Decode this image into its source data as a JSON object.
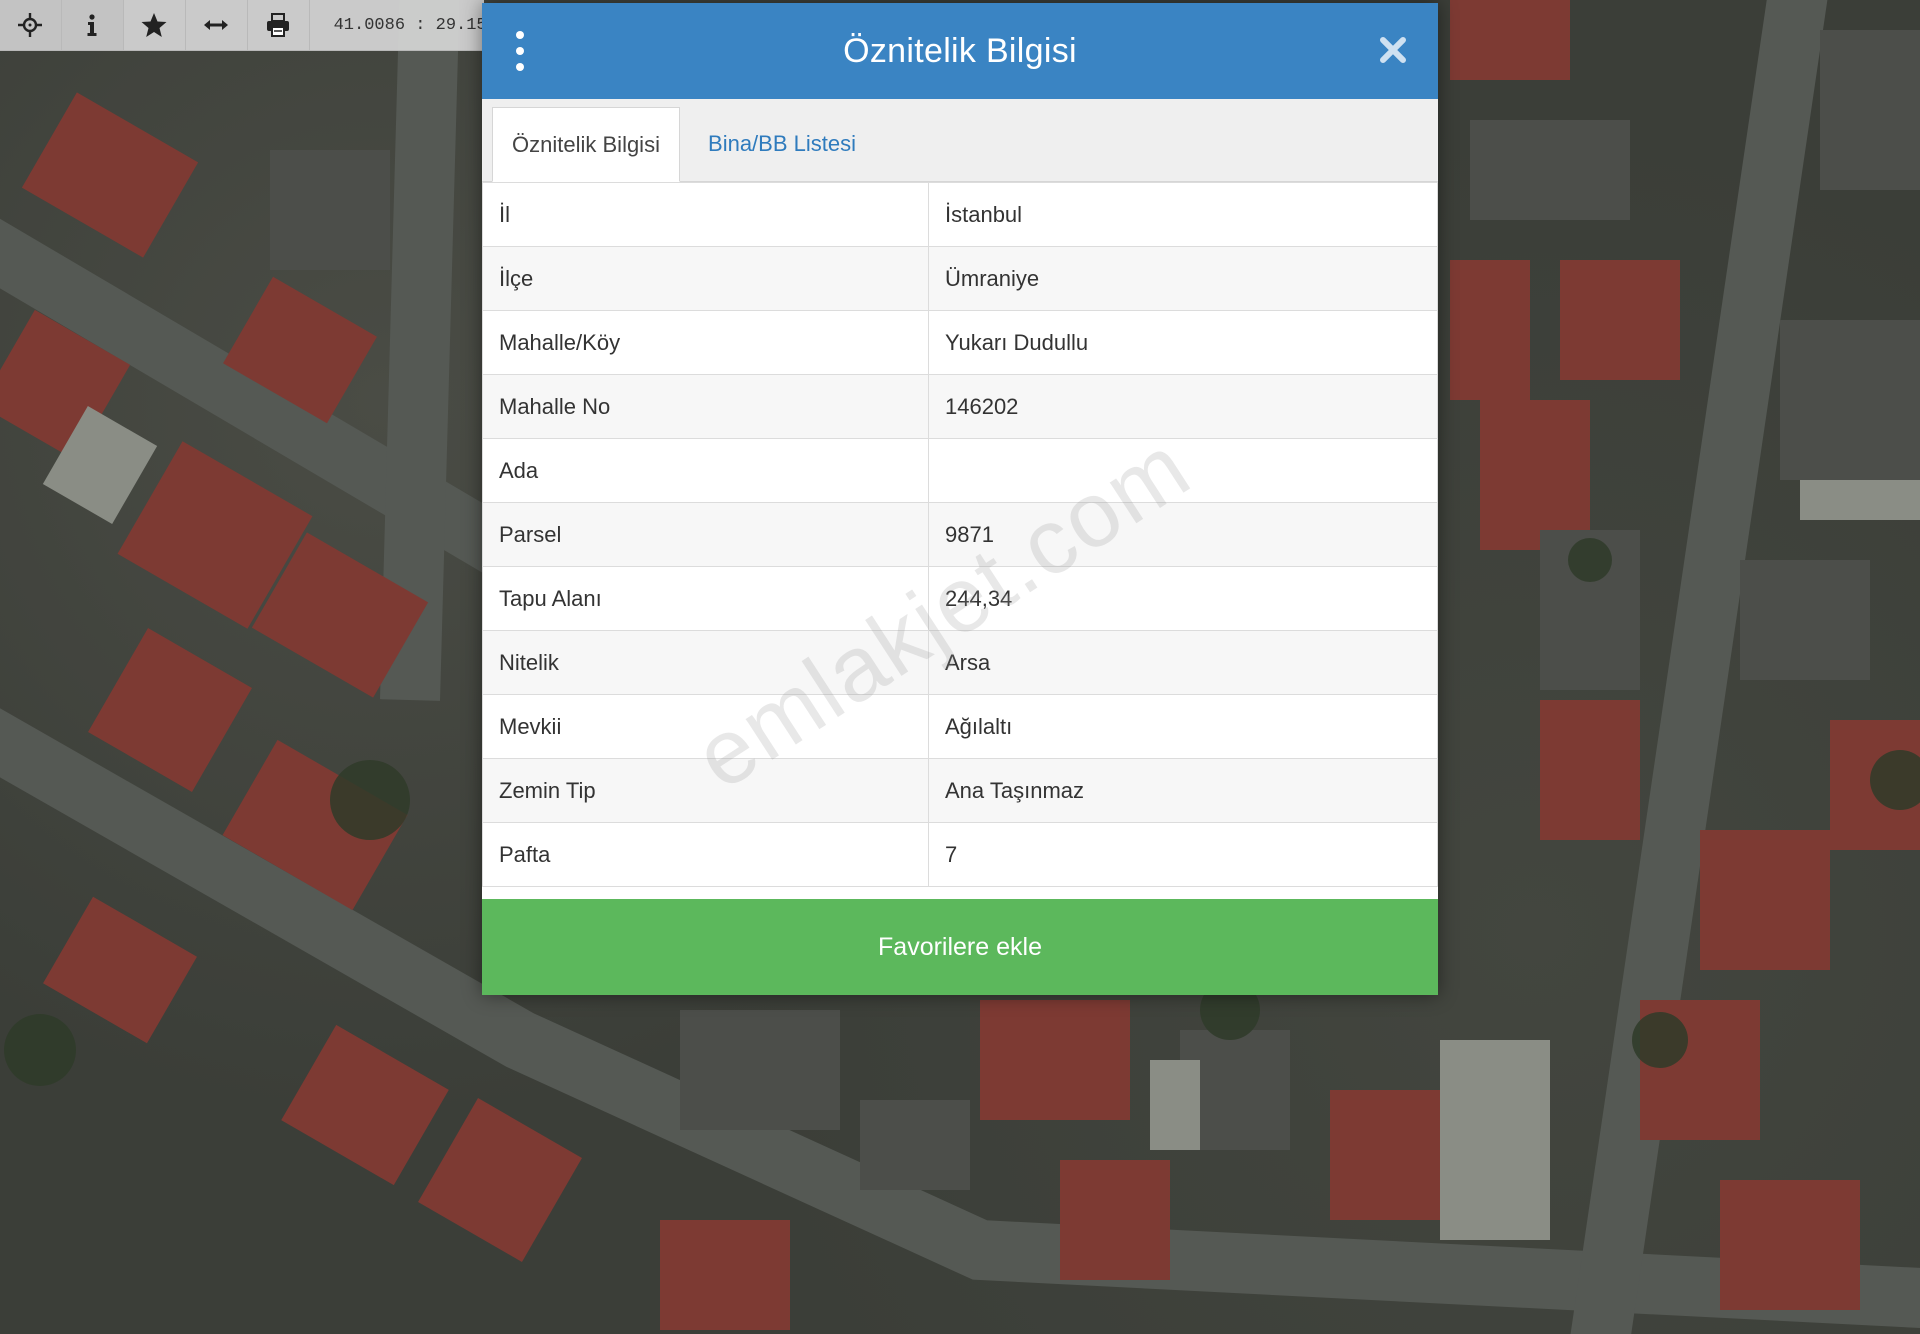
{
  "toolbar": {
    "coords": "41.0086 : 29.15",
    "tools": [
      {
        "icon": "move-icon"
      },
      {
        "icon": "info-icon"
      },
      {
        "icon": "star-icon"
      },
      {
        "icon": "measure-icon"
      },
      {
        "icon": "print-icon"
      }
    ]
  },
  "dialog": {
    "title": "Öznitelik Bilgisi",
    "menu_icon": "kebab-menu-icon",
    "close_icon": "close-icon",
    "tabs": [
      {
        "label": "Öznitelik Bilgisi",
        "active": true
      },
      {
        "label": "Bina/BB Listesi",
        "active": false
      }
    ],
    "rows": [
      {
        "key": "İl",
        "value": "İstanbul"
      },
      {
        "key": "İlçe",
        "value": "Ümraniye"
      },
      {
        "key": "Mahalle/Köy",
        "value": "Yukarı Dudullu"
      },
      {
        "key": "Mahalle No",
        "value": "146202"
      },
      {
        "key": "Ada",
        "value": ""
      },
      {
        "key": "Parsel",
        "value": "9871"
      },
      {
        "key": "Tapu Alanı",
        "value": "244,34"
      },
      {
        "key": "Nitelik",
        "value": "Arsa"
      },
      {
        "key": "Mevkii",
        "value": "Ağılaltı"
      },
      {
        "key": "Zemin Tip",
        "value": "Ana Taşınmaz"
      },
      {
        "key": "Pafta",
        "value": "7"
      }
    ],
    "favorite_label": "Favorilere ekle"
  },
  "watermark": "emlakjet.com",
  "colors": {
    "header": "#3a84c3",
    "tab_link": "#2f7bbd",
    "favorite_button": "#5cb85c"
  }
}
